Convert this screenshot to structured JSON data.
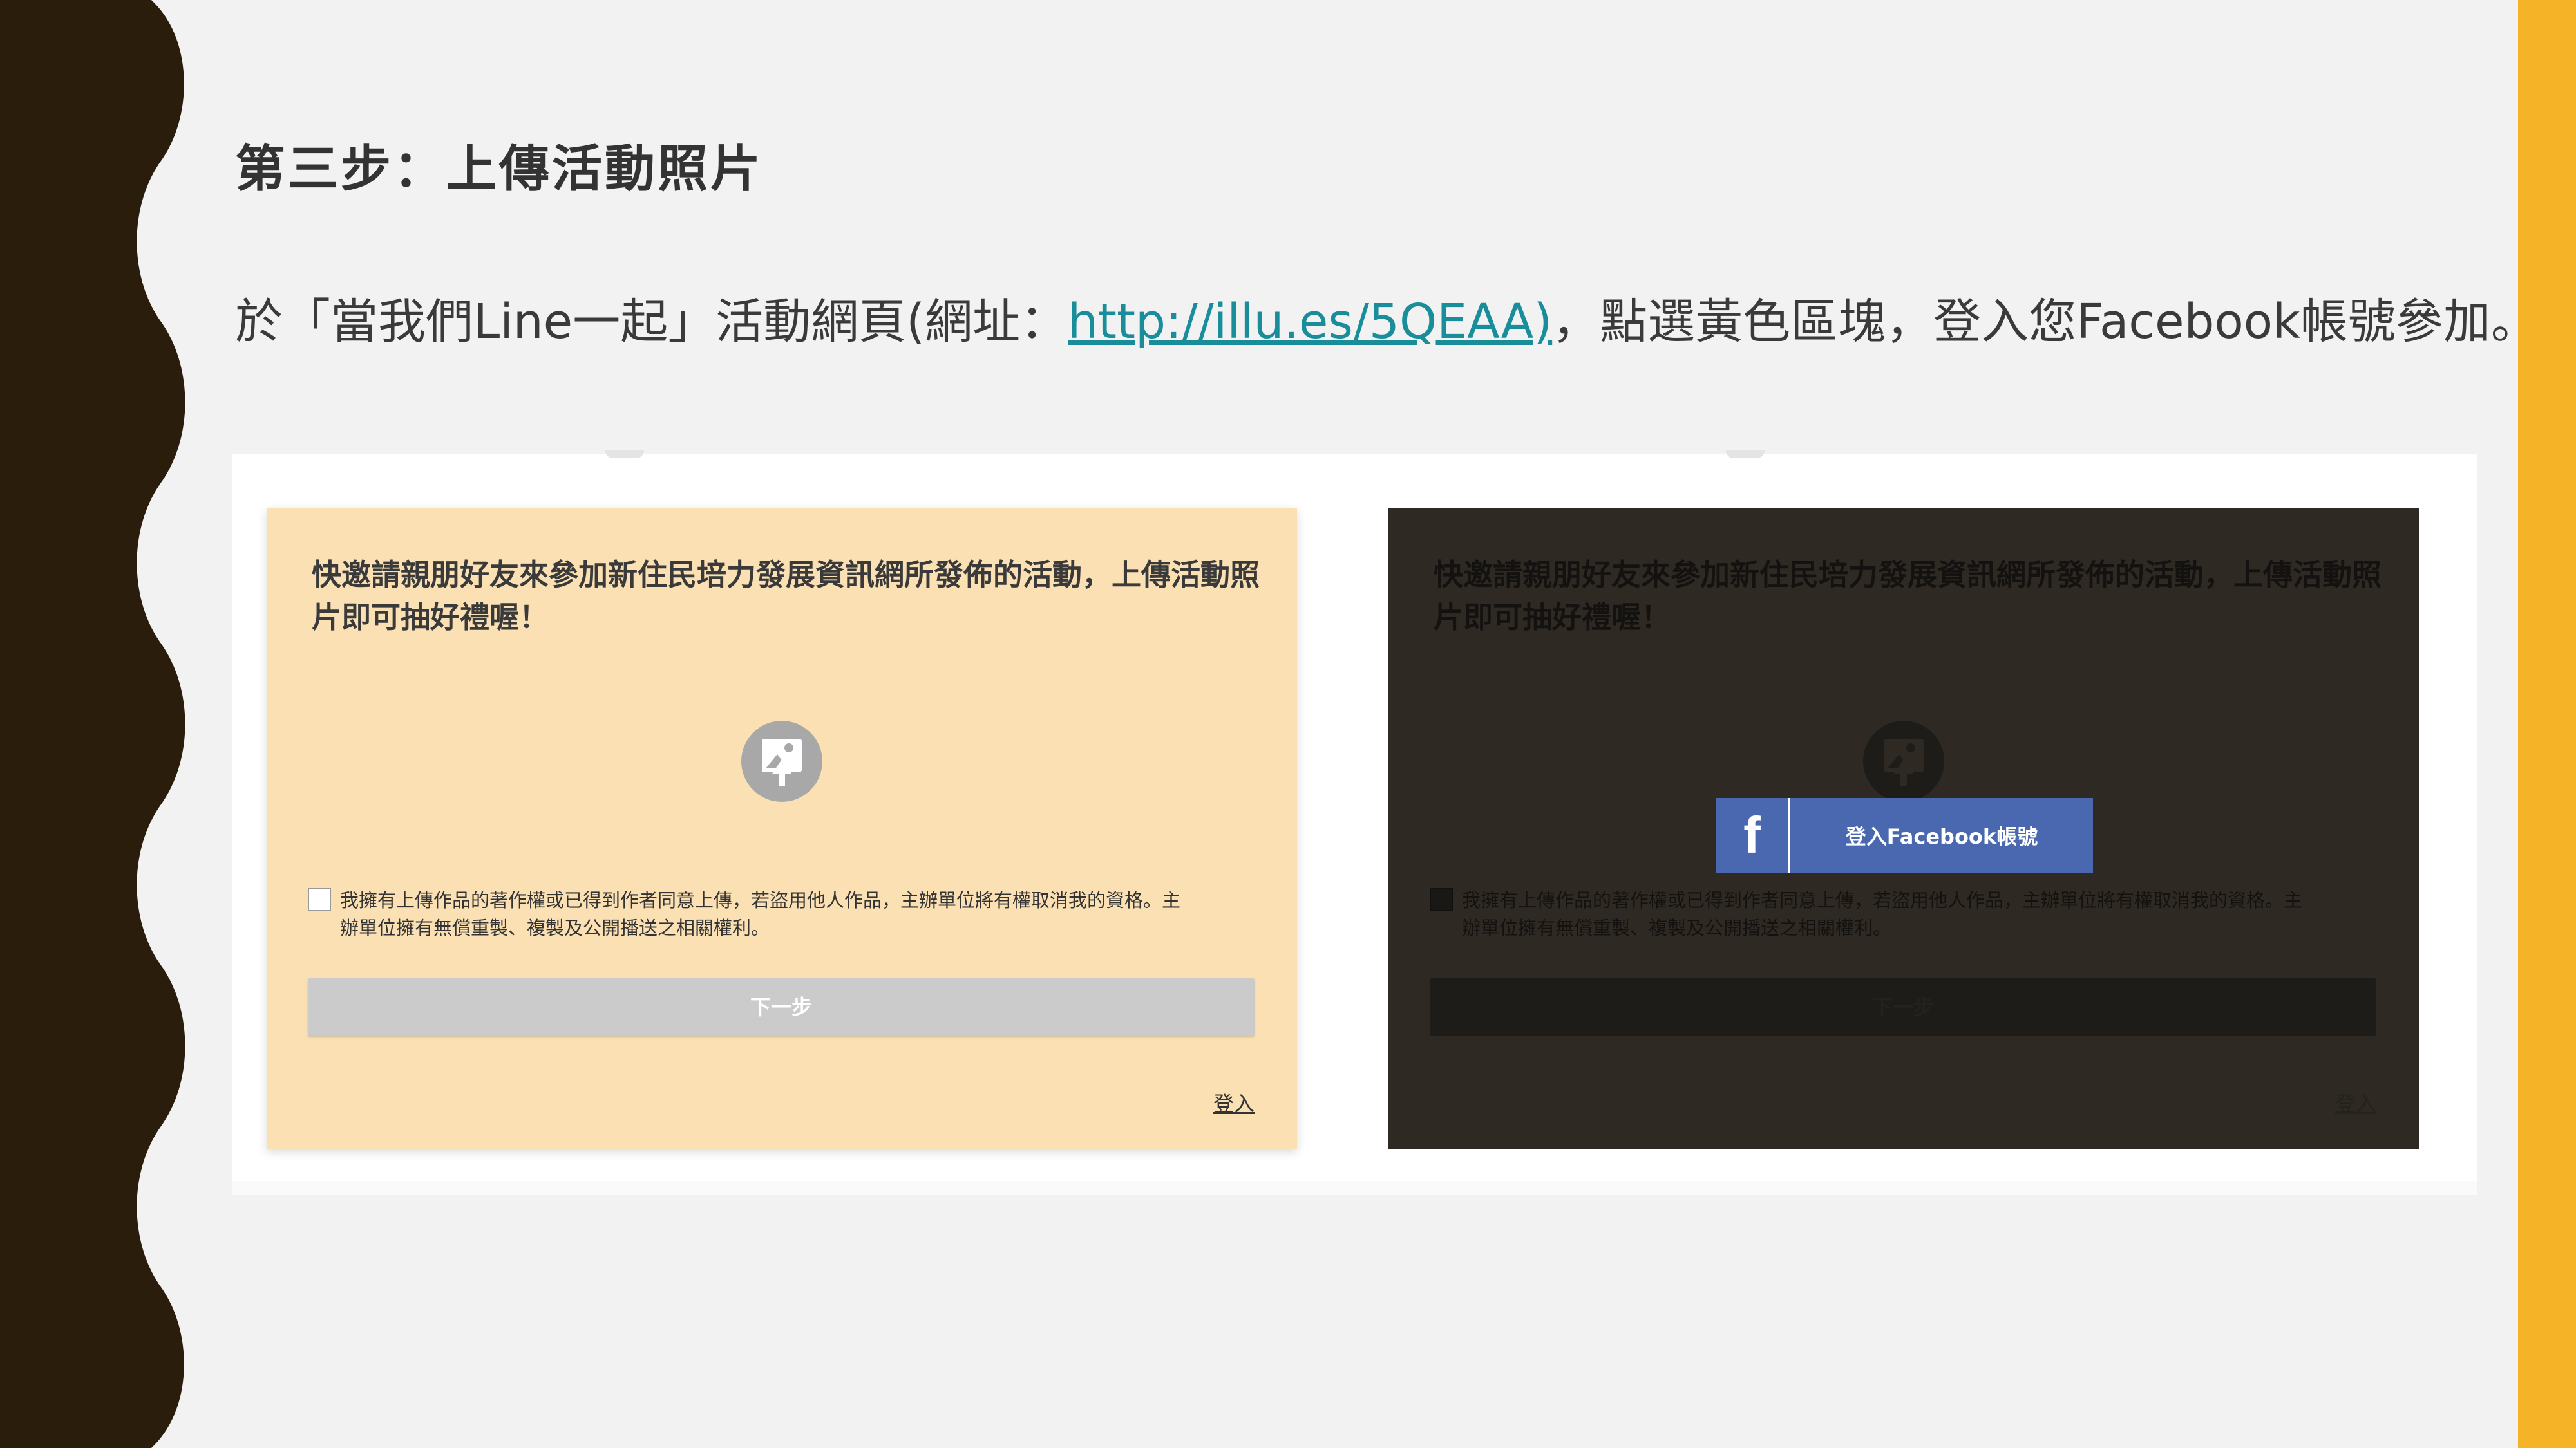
{
  "slide": {
    "title": "第三步：上傳活動照片",
    "intro_before": "於「當我們Line一起」活動網頁(網址：",
    "intro_link": "http://illu.es/5QEAA)",
    "intro_after": "，點選黃色區塊，登入您Facebook帳號參加。"
  },
  "cards": {
    "left": {
      "title": "快邀請親朋好友來參加新住民培力發展資訊網所發佈的活動，上傳活動照片即可抽好禮喔！",
      "consent": "我擁有上傳作品的著作權或已得到作者同意上傳，若盜用他人作品，主辦單位將有權取消我的資格。主辦單位擁有無償重製、複製及公開播送之相關權利。",
      "next_label": "下一步",
      "login_label": "登入"
    },
    "right": {
      "title": "快邀請親朋好友來參加新住民培力發展資訊網所發佈的活動，上傳活動照片即可抽好禮喔！",
      "consent": "我擁有上傳作品的著作權或已得到作者同意上傳，若盜用他人作品，主辦單位將有權取消我的資格。主辦單位擁有無償重製、複製及公開播送之相關權利。",
      "next_label": "下一步",
      "login_label": "登入",
      "facebook_button": {
        "logo": "f",
        "label": "登入Facebook帳號"
      }
    }
  },
  "colors": {
    "accent_bar": "#f5b328",
    "left_wave": "#2a1d0c",
    "link": "#1a8d9b",
    "card_peach": "#fbe0b4",
    "facebook_blue": "#4a68b0"
  },
  "icons": [
    "upload-photo-icon",
    "facebook-logo-icon",
    "checkbox-icon"
  ]
}
